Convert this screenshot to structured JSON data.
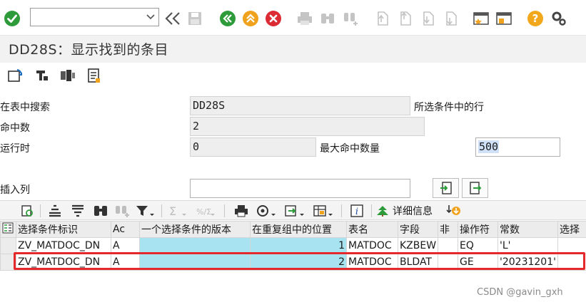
{
  "toolbar": {
    "command_value": "",
    "icons": [
      "enter-icon",
      "command-dropdown-icon",
      "back-arrows-icon",
      "save-icon",
      "back-icon",
      "exit-icon",
      "cancel-icon",
      "print-icon",
      "find-icon",
      "find-next-icon",
      "first-page-icon",
      "previous-page-icon",
      "next-page-icon",
      "last-page-icon",
      "new-session-icon",
      "shortcut-icon",
      "help-icon",
      "settings-icon"
    ]
  },
  "title": "DD28S：显示找到的条目",
  "form": {
    "search_in_table_label": "在表中搜索",
    "search_in_table_value": "DD28S",
    "selected_condition_label": "所选条件中的行",
    "hits_label": "命中数",
    "hits_value": "2",
    "runtime_label": "运行时",
    "runtime_value": "0",
    "max_hits_label": "最大命中数量",
    "max_hits_value": "500",
    "insert_col_label": "插入列",
    "insert_col_value": ""
  },
  "grid_toolbar": {
    "detail_label": "详细信息"
  },
  "table": {
    "columns": [
      "选择条件标识",
      "Ac",
      "一个选择条件的版本",
      "在重复组中的位置",
      "表名",
      "字段",
      "非",
      "操作符",
      "常数",
      "选择"
    ],
    "rows": [
      [
        "ZV_MATDOC_DN",
        "A",
        "",
        "1",
        "MATDOC",
        "KZBEW",
        "",
        "EQ",
        "'L'",
        ""
      ],
      [
        "ZV_MATDOC_DN",
        "A",
        "",
        "2",
        "MATDOC",
        "BLDAT",
        "",
        "GE",
        "'20231201'",
        ""
      ]
    ]
  },
  "watermark": "CSDN @gavin_gxh",
  "colors": {
    "green_ok": "#2e9b3b",
    "orange_nav": "#f0a21d",
    "red_cancel": "#dd2b36",
    "row_highlight": "#a7e3f1",
    "selection_box": "#e5282c",
    "help_yellow": "#f2a81d"
  }
}
